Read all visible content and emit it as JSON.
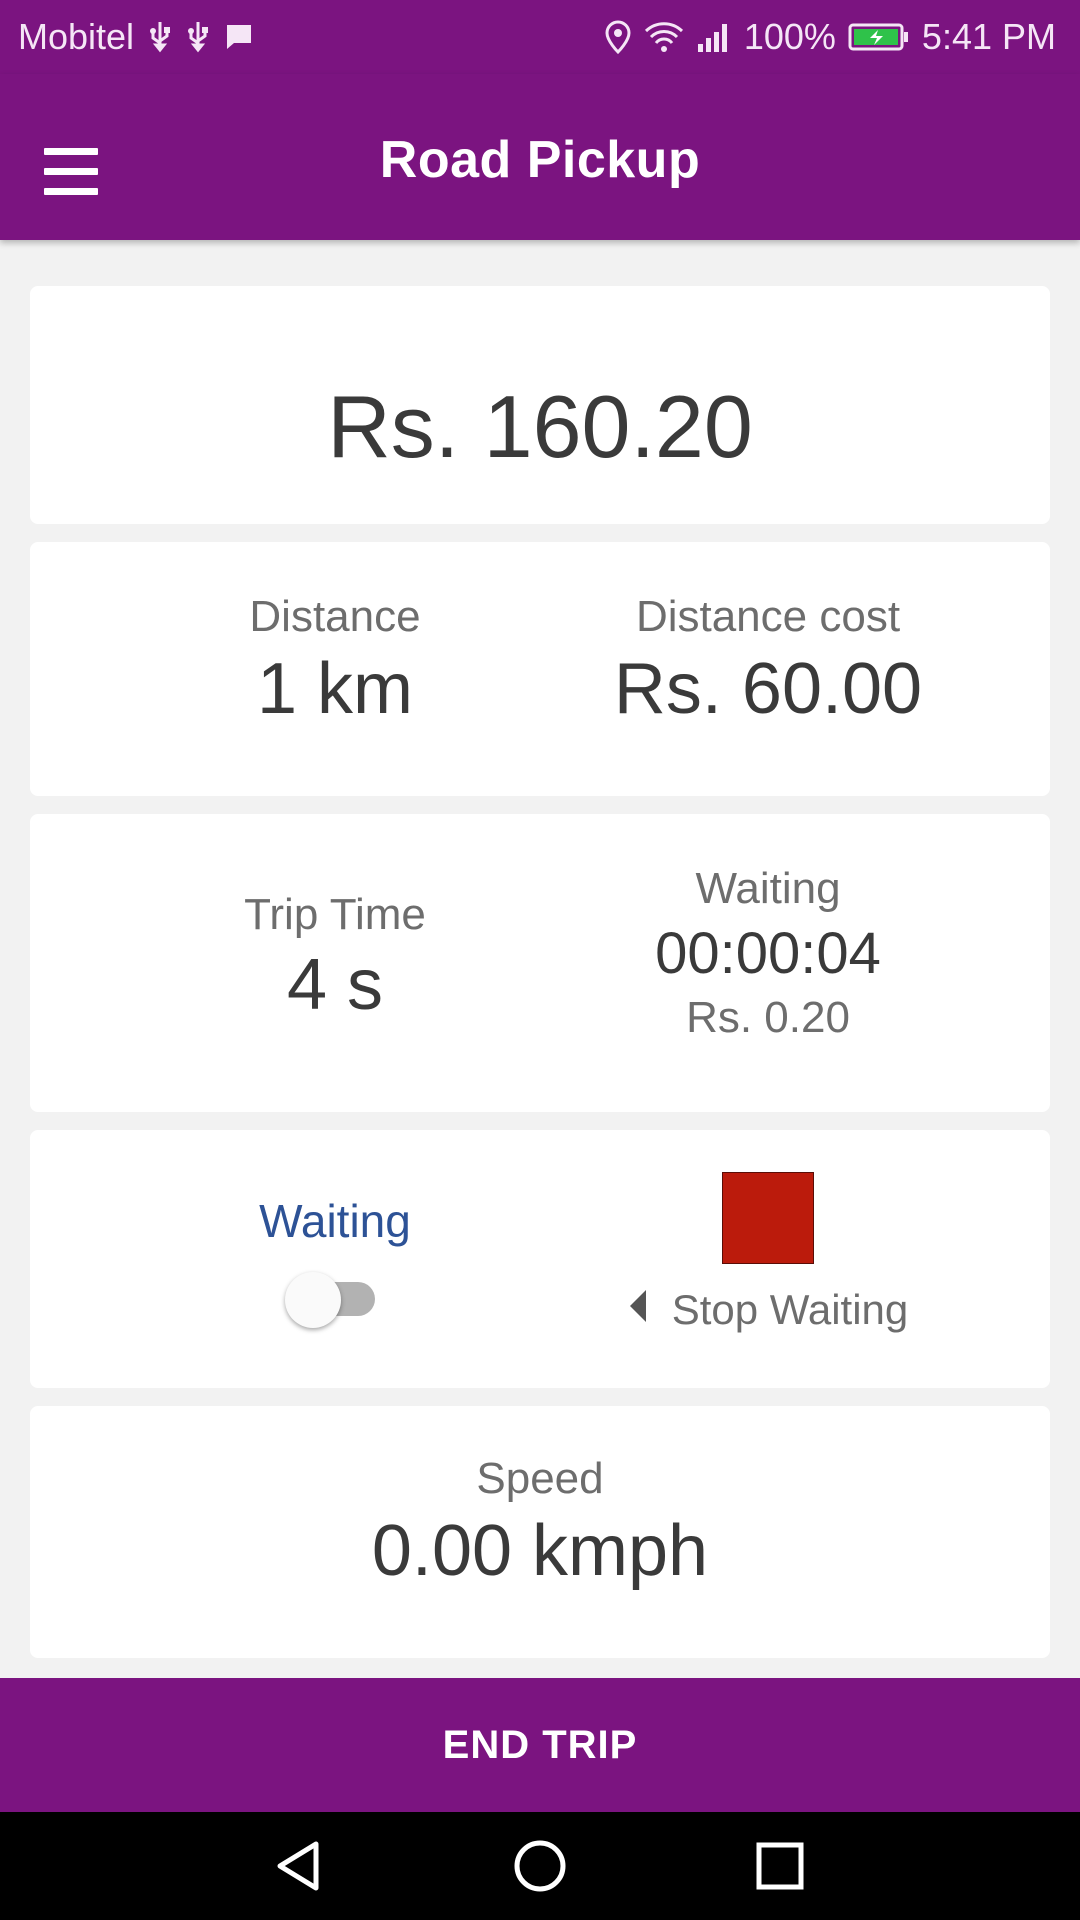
{
  "status_bar": {
    "carrier": "Mobitel",
    "battery_percent": "100%",
    "time": "5:41 PM",
    "icons": [
      "usb-icon",
      "usb-icon",
      "message-icon",
      "location-icon",
      "wifi-icon",
      "signal-icon",
      "battery-charging-icon"
    ]
  },
  "app_bar": {
    "title": "Road Pickup",
    "menu_icon": "hamburger-menu-icon"
  },
  "fare": {
    "total": "Rs. 160.20"
  },
  "distance": {
    "label": "Distance",
    "value": "1 km",
    "cost_label": "Distance cost",
    "cost_value": "Rs. 60.00"
  },
  "time": {
    "trip_label": "Trip Time",
    "trip_value": "4 s",
    "waiting_label": "Waiting",
    "waiting_value": "00:00:04",
    "waiting_cost": "Rs. 0.20"
  },
  "waiting_control": {
    "label": "Waiting",
    "toggle_on": false,
    "stop_label": "Stop Waiting",
    "stop_color": "#bb1b0c"
  },
  "speed": {
    "label": "Speed",
    "value": "0.00 kmph"
  },
  "actions": {
    "end_trip": "END TRIP"
  },
  "nav_bar": {
    "icons": [
      "back-icon",
      "home-icon",
      "recents-icon"
    ]
  },
  "colors": {
    "primary": "#7b1480",
    "accent_text": "#2d5296"
  }
}
